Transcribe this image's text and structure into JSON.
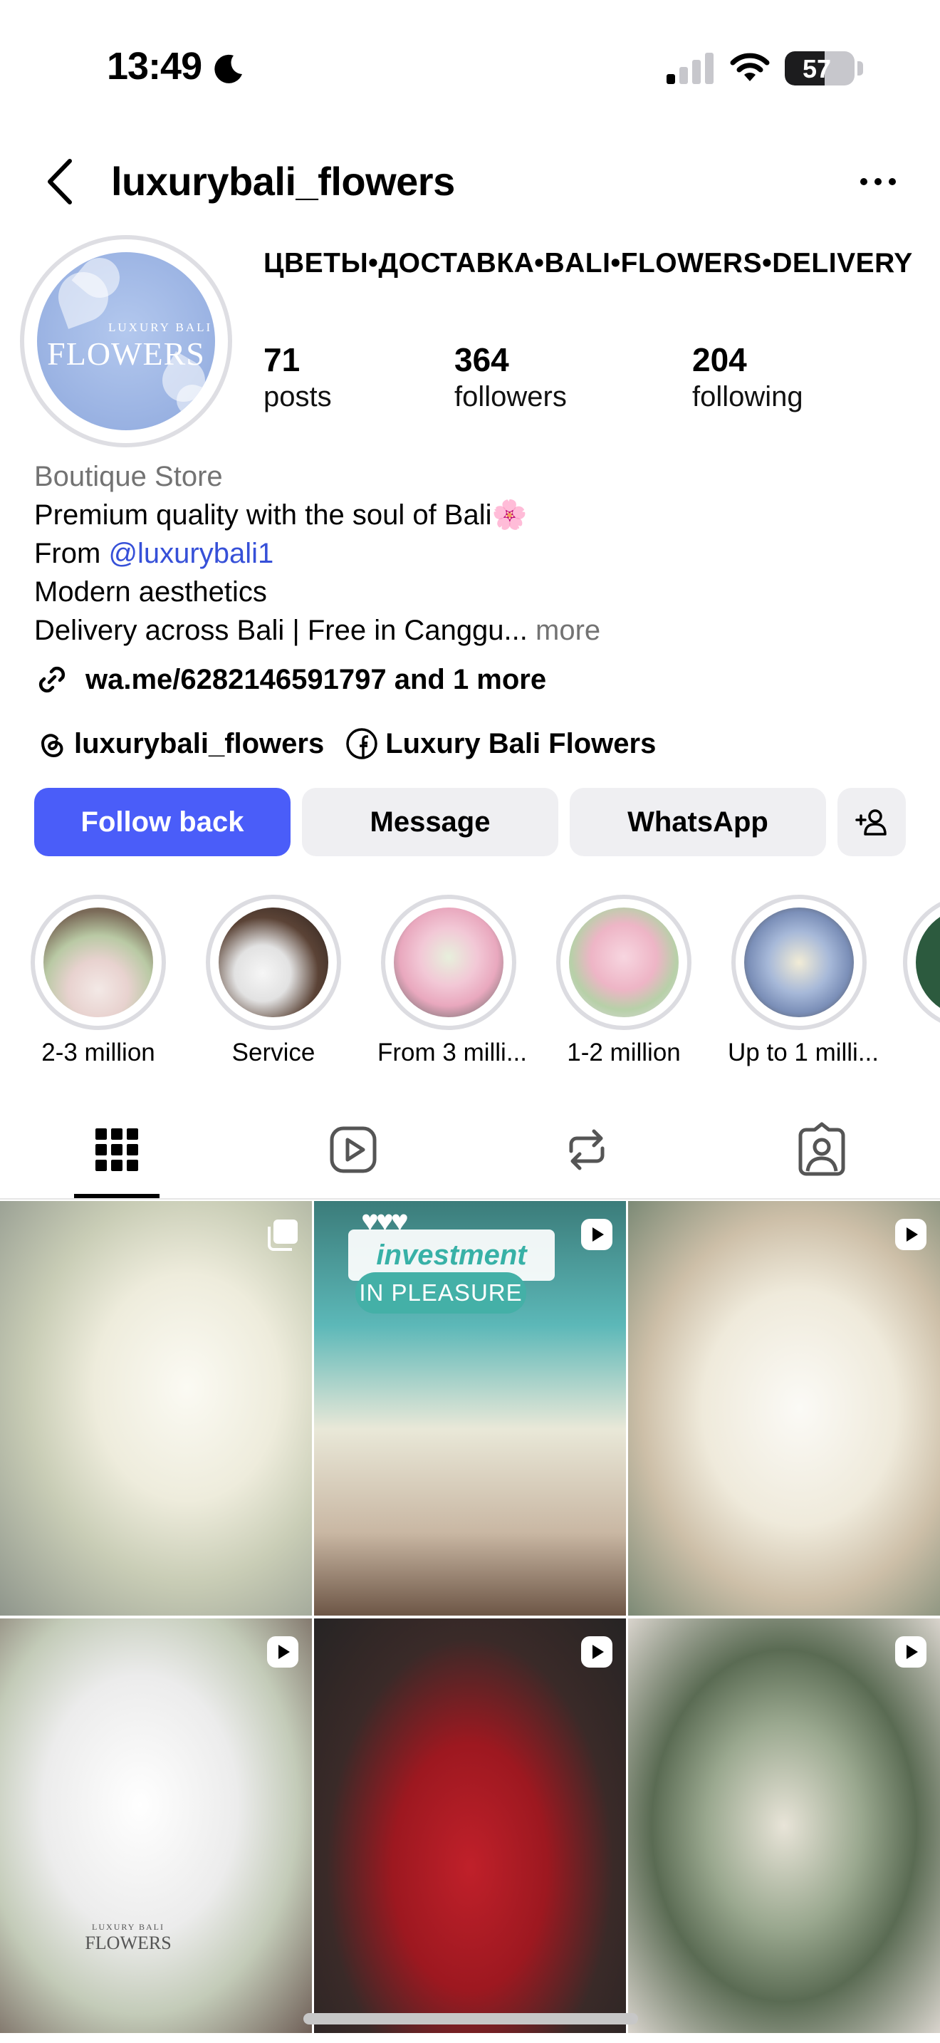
{
  "status_bar": {
    "time": "13:49",
    "battery": "57",
    "battery_level": 0.57,
    "icons": [
      "moon-icon",
      "signal-icon",
      "wifi-icon",
      "battery-icon"
    ]
  },
  "header": {
    "username": "luxurybali_flowers",
    "icons": [
      "chevron-left-icon",
      "ellipsis-icon"
    ]
  },
  "profile": {
    "avatar_text_small": "LUXURY BALI",
    "avatar_text_big": "FLOWERS",
    "name": "ЦВЕТЫ•ДОСТАВКА•BALI•FLOWERS•DELIVERY",
    "stats": {
      "posts_count": "71",
      "posts_label": "posts",
      "followers_count": "364",
      "followers_label": "followers",
      "following_count": "204",
      "following_label": "following"
    }
  },
  "bio": {
    "category": "Boutique Store",
    "line1": "Premium quality with the soul of Bali🌸",
    "line2_prefix": "From ",
    "line2_mention": "@luxurybali1",
    "line3": "Modern aesthetics",
    "line4": "Delivery across Bali | Free in Canggu...",
    "more": "more",
    "link": "wa.me/6282146591797 and 1 more",
    "threads": "luxurybali_flowers",
    "facebook": "Luxury Bali Flowers"
  },
  "actions": {
    "follow_back": "Follow back",
    "message": "Message",
    "whatsapp": "WhatsApp",
    "accent_color": "#4a5df9"
  },
  "highlights": [
    {
      "label": "2-3 million"
    },
    {
      "label": "Service"
    },
    {
      "label": "From 3 milli..."
    },
    {
      "label": "1-2 million"
    },
    {
      "label": "Up to 1 milli..."
    }
  ],
  "tabs": [
    "grid-icon",
    "reels-icon",
    "reposts-icon",
    "tagged-icon"
  ],
  "grid": {
    "post2_title": "investment",
    "post2_subtitle": "IN PLEASURE",
    "post2_hearts": "♥♥♥",
    "post5_brand_small": "LUXURY BALI",
    "post5_brand_big": "FLOWERS"
  }
}
